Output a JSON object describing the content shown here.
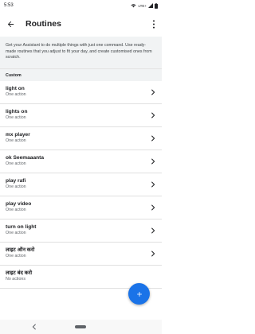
{
  "status_bar": {
    "time": "5:53",
    "network": "LTE+"
  },
  "app_bar": {
    "title": "Routines"
  },
  "intro_text": "Get your Assistant to do multiple things with just one command. Use ready-made routines that you adjust to fit your day, and create customised ones from scratch.",
  "section_label": "Custom",
  "routines": [
    {
      "title": "light on",
      "subtitle": "One action"
    },
    {
      "title": "lights on",
      "subtitle": "One action"
    },
    {
      "title": "mx player",
      "subtitle": "One action"
    },
    {
      "title": "ok Seemaaanta",
      "subtitle": "One action"
    },
    {
      "title": "play rafi",
      "subtitle": "One action"
    },
    {
      "title": "play video",
      "subtitle": "One action"
    },
    {
      "title": "turn on light",
      "subtitle": "One action"
    },
    {
      "title": "लाइट ऑन करो",
      "subtitle": "One action"
    },
    {
      "title": "लाइट बंद करो",
      "subtitle": "No actions"
    }
  ],
  "icons": {
    "back": "arrow-back-icon",
    "more": "more-vert-icon",
    "chevron": "chevron-right-icon",
    "fab": "add-icon"
  },
  "colors": {
    "accent": "#1a73e8",
    "intro_bg": "#f1f3f4"
  }
}
